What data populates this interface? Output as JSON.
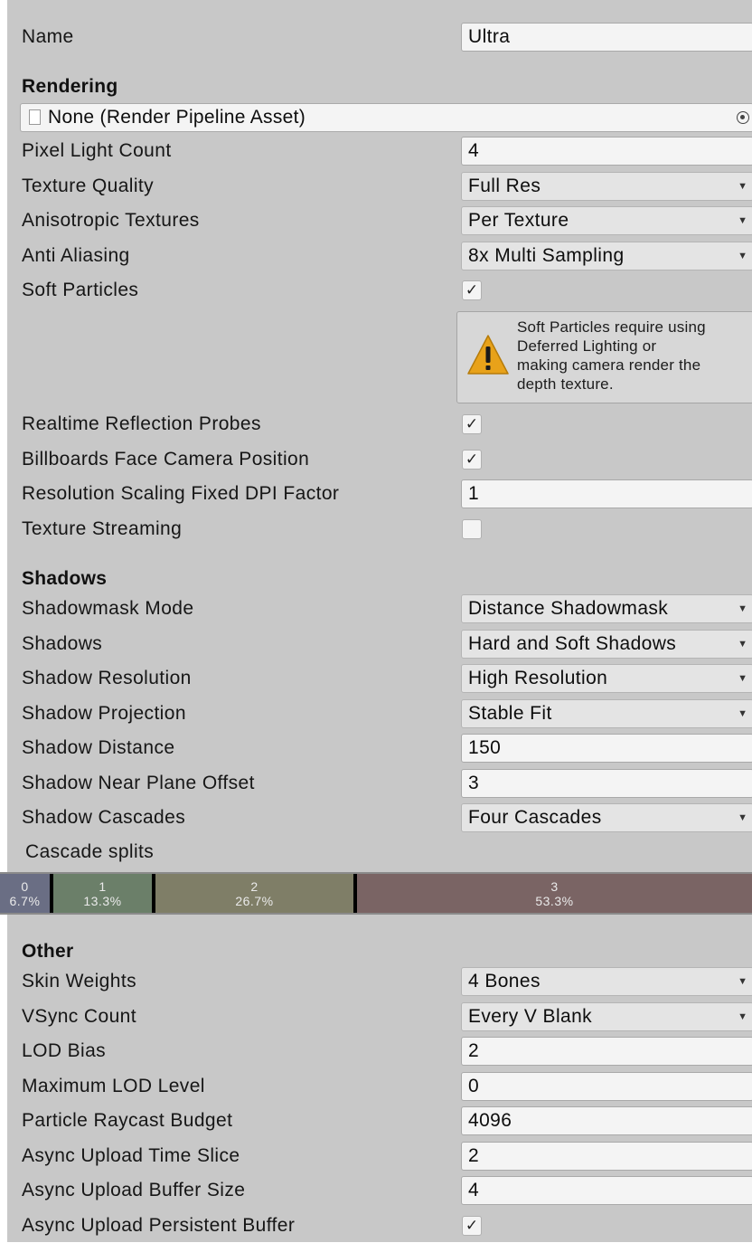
{
  "name_row": {
    "label": "Name",
    "value": "Ultra"
  },
  "rendering": {
    "header": "Rendering",
    "pipeline_asset": "None (Render Pipeline Asset)",
    "pixel_light_count": {
      "label": "Pixel Light Count",
      "value": "4"
    },
    "texture_quality": {
      "label": "Texture Quality",
      "value": "Full Res"
    },
    "anisotropic_textures": {
      "label": "Anisotropic Textures",
      "value": "Per Texture"
    },
    "anti_aliasing": {
      "label": "Anti Aliasing",
      "value": "8x Multi Sampling"
    },
    "soft_particles": {
      "label": "Soft Particles",
      "checked": true,
      "check_glyph": "✓"
    },
    "warning": {
      "line1": "Soft Particles require using",
      "line2": "Deferred Lighting or",
      "line3": "making camera render the",
      "line4": "depth texture."
    },
    "realtime_reflection_probes": {
      "label": "Realtime Reflection Probes",
      "checked": true,
      "check_glyph": "✓"
    },
    "billboards_face_camera": {
      "label": "Billboards Face Camera Position",
      "checked": true,
      "check_glyph": "✓"
    },
    "resolution_scaling_dpi": {
      "label": "Resolution Scaling Fixed DPI Factor",
      "value": "1"
    },
    "texture_streaming": {
      "label": "Texture Streaming",
      "checked": false,
      "check_glyph": ""
    }
  },
  "shadows": {
    "header": "Shadows",
    "shadowmask_mode": {
      "label": "Shadowmask Mode",
      "value": "Distance Shadowmask"
    },
    "shadows": {
      "label": "Shadows",
      "value": "Hard and Soft Shadows"
    },
    "shadow_resolution": {
      "label": "Shadow Resolution",
      "value": "High Resolution"
    },
    "shadow_projection": {
      "label": "Shadow Projection",
      "value": "Stable Fit"
    },
    "shadow_distance": {
      "label": "Shadow Distance",
      "value": "150"
    },
    "shadow_near_plane_offset": {
      "label": "Shadow Near Plane Offset",
      "value": "3"
    },
    "shadow_cascades": {
      "label": "Shadow Cascades",
      "value": "Four Cascades"
    },
    "cascade_splits_label": "Cascade splits",
    "cascade_splits": [
      {
        "index": "0",
        "percent": "6.7%",
        "fraction": 0.067,
        "color": "#6a6e84"
      },
      {
        "index": "1",
        "percent": "13.3%",
        "fraction": 0.133,
        "color": "#6b7f69"
      },
      {
        "index": "2",
        "percent": "26.7%",
        "fraction": 0.267,
        "color": "#7f7e67"
      },
      {
        "index": "3",
        "percent": "53.3%",
        "fraction": 0.533,
        "color": "#7a6464"
      }
    ]
  },
  "other": {
    "header": "Other",
    "skin_weights": {
      "label": "Skin Weights",
      "value": "4 Bones"
    },
    "vsync_count": {
      "label": "VSync Count",
      "value": "Every V Blank"
    },
    "lod_bias": {
      "label": "LOD Bias",
      "value": "2"
    },
    "maximum_lod_level": {
      "label": "Maximum LOD Level",
      "value": "0"
    },
    "particle_raycast_budget": {
      "label": "Particle Raycast Budget",
      "value": "4096"
    },
    "async_upload_time_slice": {
      "label": "Async Upload Time Slice",
      "value": "2"
    },
    "async_upload_buffer_size": {
      "label": "Async Upload Buffer Size",
      "value": "4"
    },
    "async_upload_persistent_buffer": {
      "label": "Async Upload Persistent Buffer",
      "checked": true,
      "check_glyph": "✓"
    }
  },
  "icons": {
    "dropdown": "▼",
    "warning": "warning-triangle-icon",
    "object_picker": "object-picker-icon",
    "asset": "asset-document-icon"
  }
}
